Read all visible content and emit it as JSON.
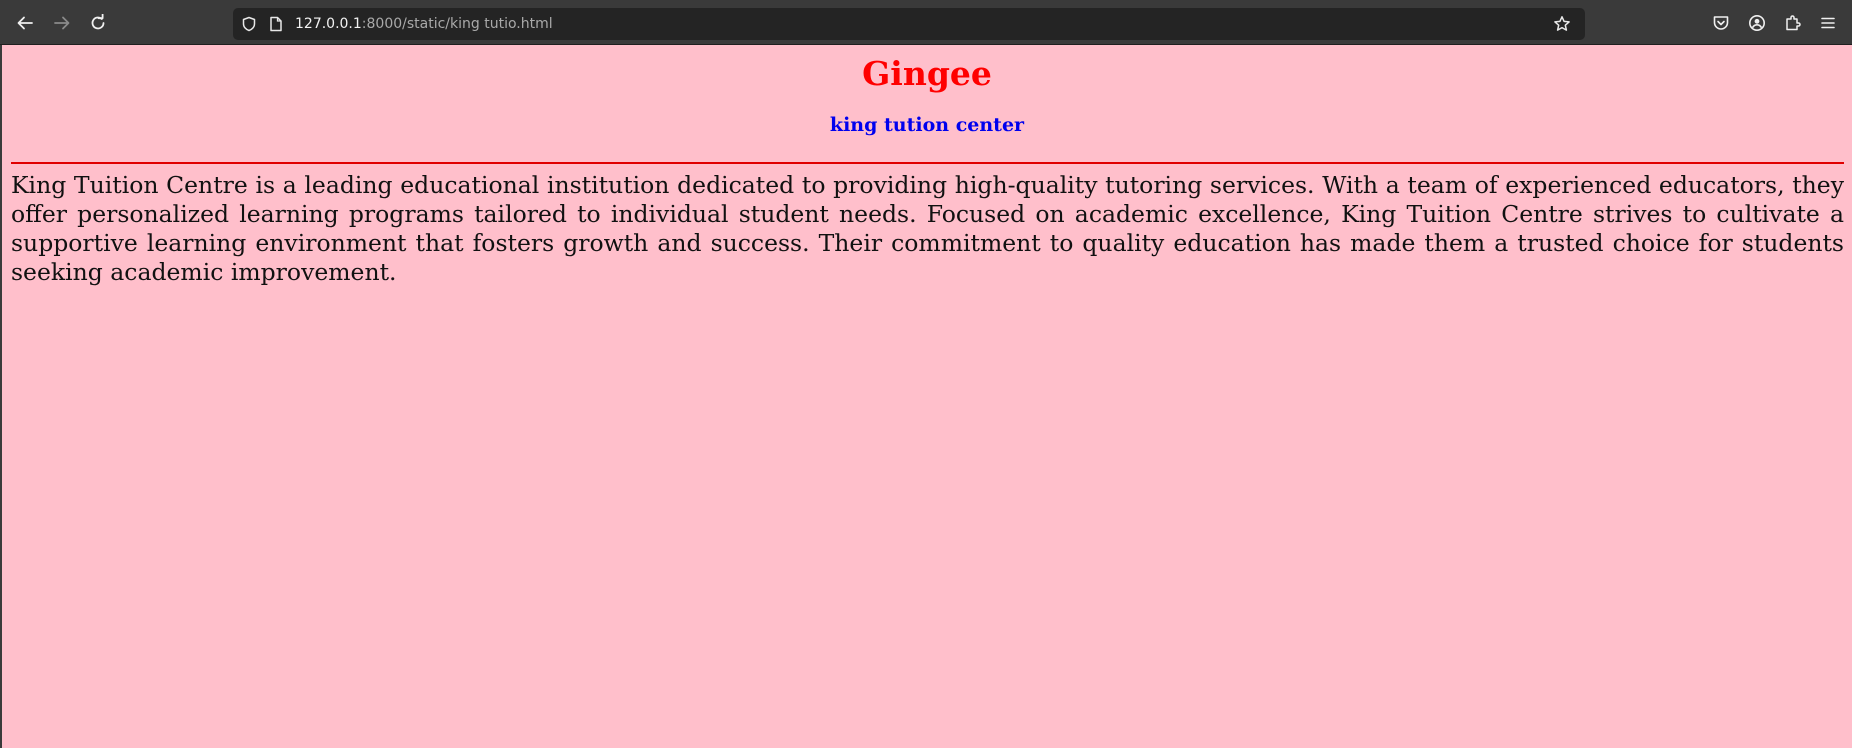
{
  "browser": {
    "url_host": "127.0.0.1",
    "url_path": ":8000/static/king tutio.html",
    "icons": {
      "back": "arrow-left-icon",
      "forward": "arrow-right-icon",
      "reload": "reload-icon",
      "site_info": "shield-icon",
      "page": "page-icon",
      "bookmark": "star-icon",
      "pocket": "pocket-icon",
      "account": "account-icon",
      "extensions": "puzzle-icon",
      "menu": "hamburger-menu-icon"
    }
  },
  "page": {
    "background_color": "#ffbfcb",
    "title": "Gingee",
    "title_color": "#ff0000",
    "subtitle": "king tution center",
    "subtitle_color": "#0000ee",
    "divider_color": "#e00000",
    "description": "King Tuition Centre is a leading educational institution dedicated to providing high-quality tutoring services. With a team of experienced educators, they offer personalized learning programs tailored to individual student needs. Focused on academic excellence, King Tuition Centre strives to cultivate a supportive learning environment that fosters growth and success. Their commitment to quality education has made them a trusted choice for students seeking academic improvement."
  }
}
